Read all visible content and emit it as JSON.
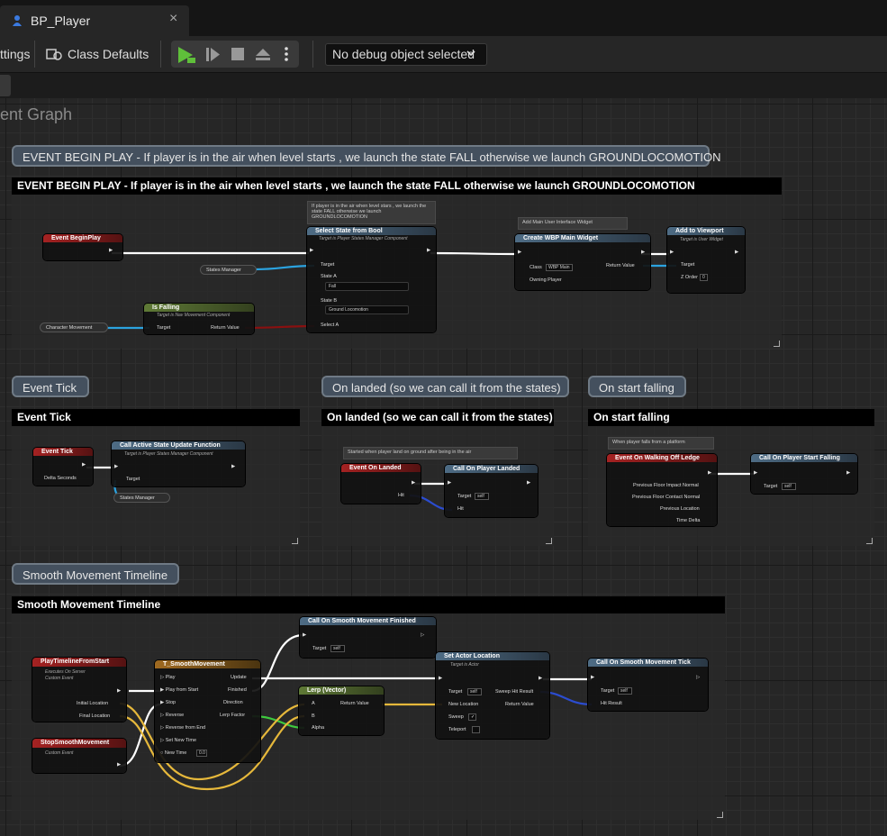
{
  "window": {
    "tab_label": "BP_Player",
    "tab_close": "×"
  },
  "toolbar": {
    "settings_partial": "ttings",
    "class_defaults": "Class Defaults",
    "debug_select": "No debug object selected"
  },
  "graph": {
    "title_partial": "ent Graph"
  },
  "comments": {
    "begin_play": {
      "bubble": "EVENT BEGIN PLAY - If player is in the air when level starts , we launch the state FALL otherwise we launch GROUNDLOCOMOTION",
      "header": "EVENT BEGIN PLAY - If player is in the air when level starts , we launch the state FALL otherwise we launch GROUNDLOCOMOTION"
    },
    "event_tick": {
      "bubble": "Event Tick",
      "header": "Event Tick"
    },
    "on_landed": {
      "bubble": "On landed (so we can call it from the states)",
      "header": "On landed (so we can call it from the states)"
    },
    "on_start_falling": {
      "bubble": "On start falling",
      "header": "On start falling"
    },
    "smooth": {
      "bubble": "Smooth Movement Timeline",
      "header": "Smooth Movement Timeline"
    }
  },
  "nodes": {
    "event_begin_play": {
      "title": "Event BeginPlay"
    },
    "states_manager_var": "States Manager",
    "character_movement_var": "Character Movement",
    "is_falling": {
      "title": "Is Falling",
      "subtitle": "Target is Nav Movement Component",
      "target": "Target",
      "return": "Return Value"
    },
    "select_state": {
      "comment": "If player is in the air when level stars , we launch the state FALL otherwise we launch GROUNDLOCOMOTION",
      "title": "Select State from Bool",
      "subtitle": "Target is Player States Manager Component",
      "target": "Target",
      "state_a": "State A",
      "state_a_value": "Fall",
      "state_b": "State B",
      "state_b_value": "Ground Locomotion",
      "select_a": "Select A"
    },
    "create_widget": {
      "comment": "Add Main User Interface Widget",
      "title": "Create WBP Main Widget",
      "class": "Class",
      "class_value": "WBP Main",
      "return": "Return Value",
      "owning_player": "Owning Player"
    },
    "add_viewport": {
      "title": "Add to Viewport",
      "subtitle": "Target is User Widget",
      "target": "Target",
      "zorder": "Z Order",
      "zorder_value": "0"
    },
    "event_tick": {
      "title": "Event Tick",
      "delta": "Delta Seconds"
    },
    "call_active_state": {
      "title": "Call Active State Update Function",
      "subtitle": "Target is Player States Manager Component",
      "target": "Target"
    },
    "states_manager_var2": "States Manager",
    "event_on_landed": {
      "comment": "Started when player land on ground after being in the air",
      "title": "Event On Landed",
      "hit": "Hit"
    },
    "call_on_player_landed": {
      "title": "Call On Player Landed",
      "target": "Target",
      "target_value": "self",
      "hit": "Hit"
    },
    "walking_off_ledge": {
      "comment": "When player falls from a platform",
      "title": "Event On Walking Off Ledge",
      "pins": [
        "Previous Floor Impact Normal",
        "Previous Floor Contact Normal",
        "Previous Location",
        "Time Delta"
      ]
    },
    "call_start_falling": {
      "title": "Call On Player Start Falling",
      "target": "Target",
      "target_value": "self"
    },
    "play_timeline_from_start": {
      "title": "PlayTimelineFromStart",
      "sub1": "Executes On Server",
      "sub2": "Custom Event",
      "initial": "Initial Location",
      "final": "Final Location"
    },
    "stop_smooth": {
      "title": "StopSmoothMovement",
      "sub": "Custom Event"
    },
    "timeline": {
      "title": "T_SmoothMovement",
      "inputs": [
        "Play",
        "Play from Start",
        "Stop",
        "Reverse",
        "Reverse from End",
        "Set New Time",
        "New Time"
      ],
      "new_time_value": "0.0",
      "outputs": [
        "Update",
        "Finished",
        "Direction",
        "Lerp Factor"
      ]
    },
    "call_finished": {
      "title": "Call On Smooth Movement Finished",
      "target": "Target",
      "target_value": "self"
    },
    "lerp": {
      "title": "Lerp (Vector)",
      "a": "A",
      "b": "B",
      "alpha": "Alpha",
      "return": "Return Value"
    },
    "set_actor_location": {
      "title": "Set Actor Location",
      "subtitle": "Target is Actor",
      "target": "Target",
      "target_value": "self",
      "new_location": "New Location",
      "sweep": "Sweep",
      "teleport": "Teleport",
      "sweep_hit": "Sweep Hit Result",
      "return": "Return Value"
    },
    "call_tick": {
      "title": "Call On Smooth Movement Tick",
      "target": "Target",
      "target_value": "self",
      "hit": "Hit Result"
    }
  }
}
